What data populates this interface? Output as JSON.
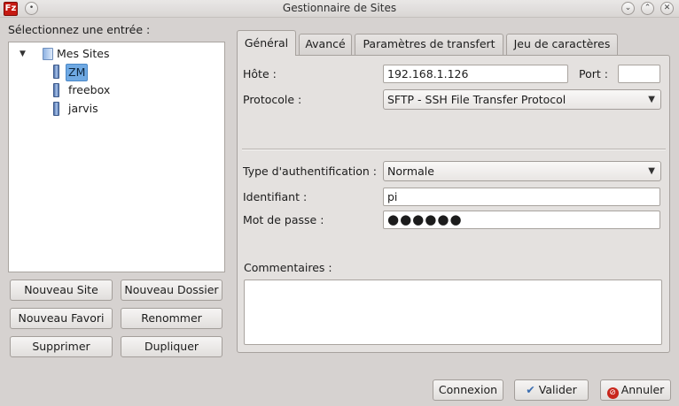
{
  "window": {
    "title": "Gestionnaire de Sites",
    "app_icon_text": "Fz"
  },
  "left": {
    "select_label": "Sélectionnez une entrée :",
    "tree": {
      "root": {
        "label": "Mes Sites",
        "expanded": true
      },
      "children": [
        {
          "label": "ZM",
          "selected": true
        },
        {
          "label": "freebox",
          "selected": false
        },
        {
          "label": "jarvis",
          "selected": false
        }
      ]
    },
    "buttons": {
      "new_site": "Nouveau Site",
      "new_folder": "Nouveau Dossier",
      "new_bookmark": "Nouveau Favori",
      "rename": "Renommer",
      "delete": "Supprimer",
      "duplicate": "Dupliquer"
    }
  },
  "tabs": [
    {
      "label": "Général",
      "active": true
    },
    {
      "label": "Avancé",
      "active": false
    },
    {
      "label": "Paramètres de transfert",
      "active": false
    },
    {
      "label": "Jeu de caractères",
      "active": false
    }
  ],
  "general": {
    "host_label": "Hôte :",
    "host_value": "192.168.1.126",
    "port_label": "Port :",
    "port_value": "",
    "protocol_label": "Protocole :",
    "protocol_value": "SFTP - SSH File Transfer Protocol",
    "auth_type_label": "Type d'authentification :",
    "auth_type_value": "Normale",
    "user_label": "Identifiant :",
    "user_value": "pi",
    "password_label": "Mot de passe :",
    "password_mask": "●●●●●●",
    "comments_label": "Commentaires :",
    "comments_value": ""
  },
  "footer": {
    "connect": "Connexion",
    "ok": "Valider",
    "cancel": "Annuler"
  },
  "colors": {
    "window_bg": "#d6d2d0",
    "selection": "#6fa9e3",
    "cancel_red": "#c8261c"
  }
}
